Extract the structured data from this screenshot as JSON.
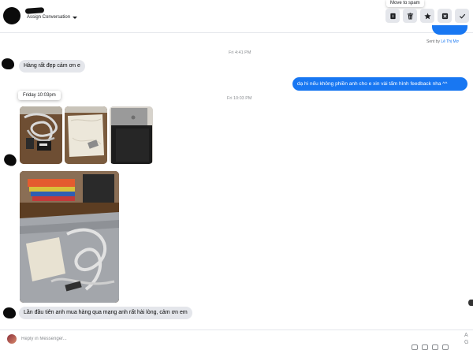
{
  "header": {
    "assign_label": "Assign Conversation",
    "tooltip": "Move to spam",
    "actions": [
      {
        "name": "mark-unread-button",
        "icon": "unread-icon"
      },
      {
        "name": "delete-button",
        "icon": "trash-icon"
      },
      {
        "name": "star-button",
        "icon": "star-icon"
      },
      {
        "name": "spam-button",
        "icon": "spam-icon"
      },
      {
        "name": "done-button",
        "icon": "check-icon"
      }
    ]
  },
  "thread": {
    "sent_by_prefix": "Sent by ",
    "sent_by_name": "Lê Thị Mơ",
    "timestamp_1": "Fri 4:41 PM",
    "timestamp_2": "Fri 10:03 PM",
    "message_1": "Hàng rất đẹp cảm ơn e",
    "message_2": "dạ hi  nếu không phiền anh cho e xin vài tấm hình feedback nha ^^",
    "date_popup": "Friday 10:03pm",
    "message_3": "Lần đầu tiên anh mua hàng qua mạng anh rất hài lòng, cảm ơn em"
  },
  "composer": {
    "placeholder": "Reply in Messenger...",
    "side_letters": "A\nG"
  },
  "colors": {
    "accent": "#1877f2",
    "incoming_bubble": "#e4e6eb"
  }
}
